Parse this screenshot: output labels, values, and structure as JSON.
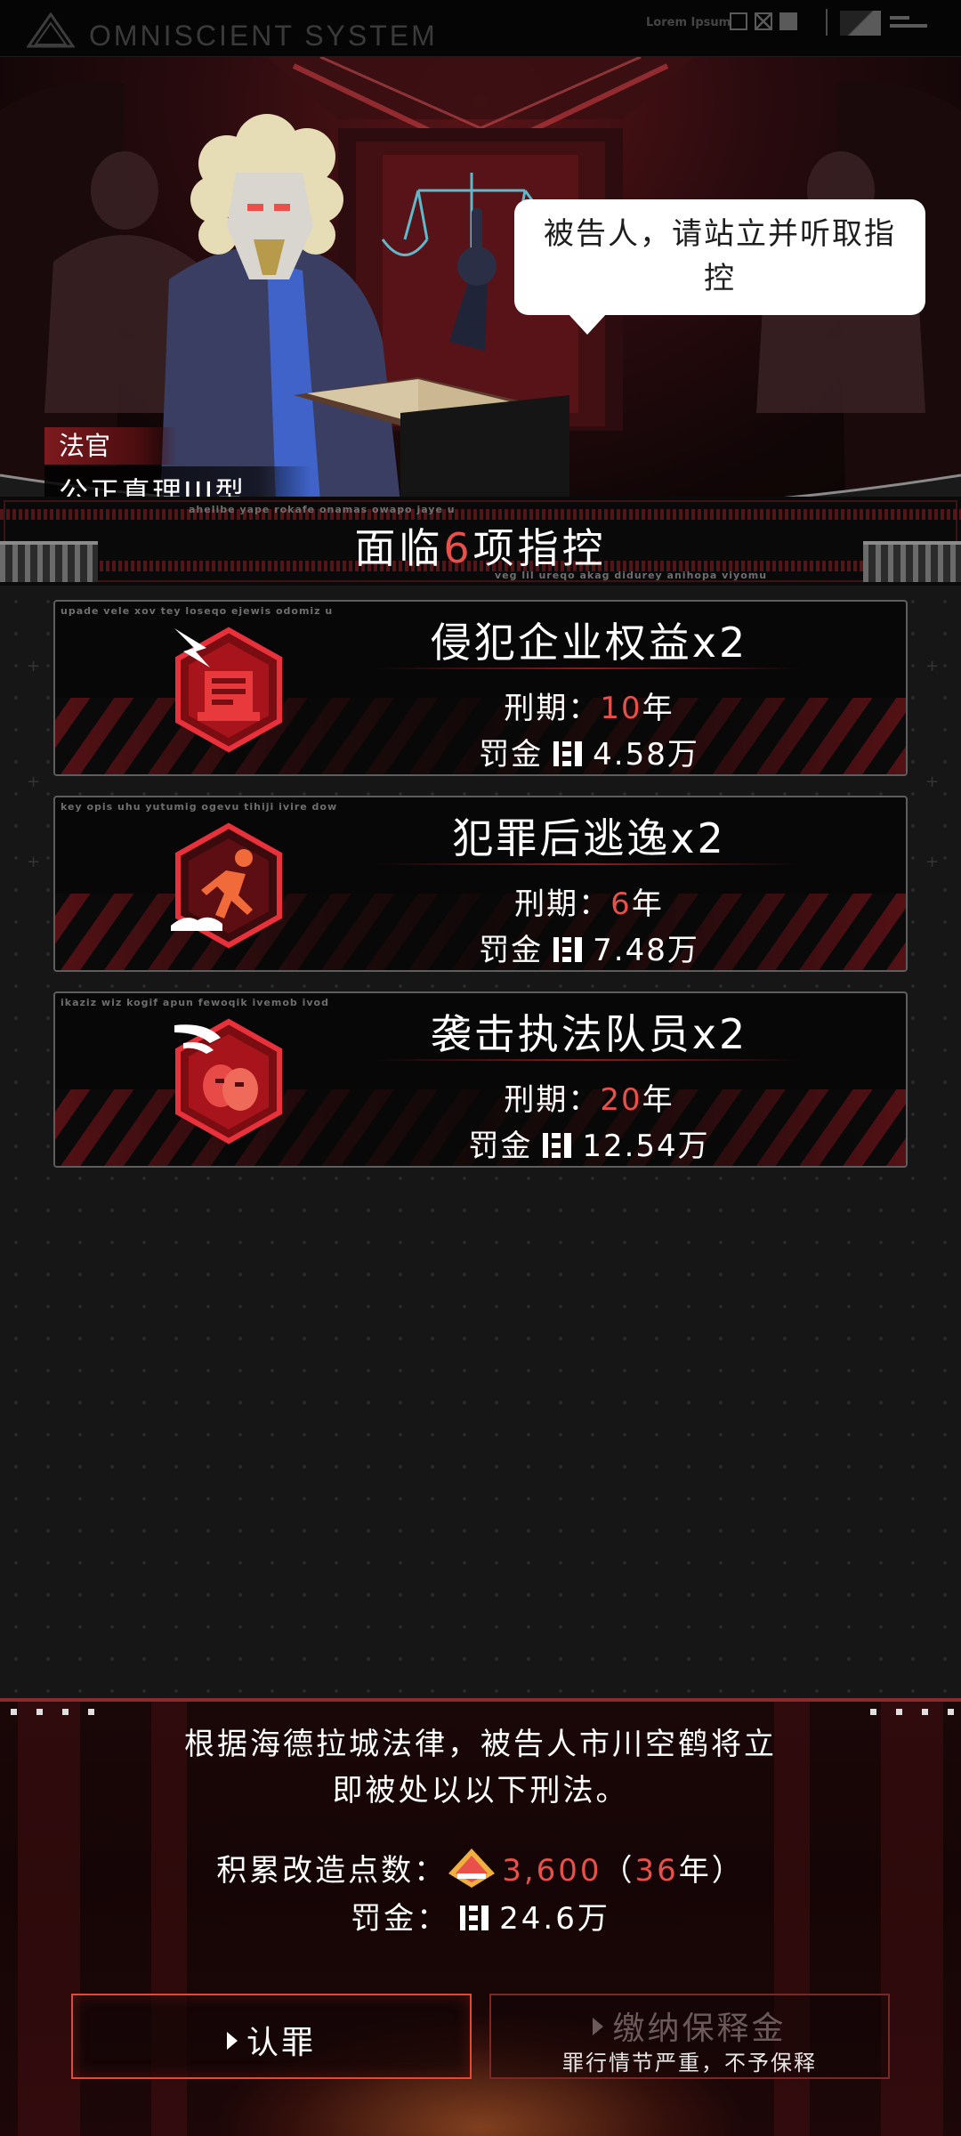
{
  "system": {
    "title": "OMNISCIENT SYSTEM",
    "lorem": "Lorem Ipsum"
  },
  "scene": {
    "speech": "被告人，请站立并听取指控",
    "judge_role": "法官",
    "judge_name": "公正真理III型"
  },
  "banner": {
    "prefix": "面临",
    "count": "6",
    "suffix": "项指控",
    "micro_top": "ahelibe yape rokafe onamas owapo jaye u",
    "micro_bottom": "veg lil ureqo akag didurey anihopa viyomu"
  },
  "charges": [
    {
      "title": "侵犯企业权益x2",
      "micro": "upade vele xov tey loseqo ejewis odomiz u",
      "term_label": "刑期：",
      "term_value": "10",
      "term_unit": "年",
      "fine_label": "罚金",
      "fine_value": "4.58万",
      "icon": "corporate-rights-icon"
    },
    {
      "title": "犯罪后逃逸x2",
      "micro": "key opis uhu yutumig ogevu tihiji ivire dow",
      "term_label": "刑期：",
      "term_value": "6",
      "term_unit": "年",
      "fine_label": "罚金",
      "fine_value": "7.48万",
      "icon": "escape-runner-icon"
    },
    {
      "title": "袭击执法队员x2",
      "micro": "ikaziz wiz kogif apun fewoqik ivemob ivod",
      "term_label": "刑期：",
      "term_value": "20",
      "term_unit": "年",
      "fine_label": "罚金",
      "fine_value": "12.54万",
      "icon": "assault-officer-icon"
    }
  ],
  "verdict": {
    "line1": "根据海德拉城法律，被告人市川空鹤将立",
    "line2": "即被处以以下刑法。",
    "points_label": "积累改造点数：",
    "points_value": "3,600",
    "points_paren_open": "（",
    "points_years": "36",
    "points_unit": "年",
    "points_paren_close": "）",
    "fine_label": "罚金：",
    "fine_value": "24.6万"
  },
  "buttons": {
    "plead": "认罪",
    "bail": "缴纳保释金",
    "bail_sub": "罪行情节严重，不予保释"
  },
  "colors": {
    "accent": "#e8504a",
    "card_border": "#5e5e5e",
    "stripe_red": "#5c1216"
  }
}
